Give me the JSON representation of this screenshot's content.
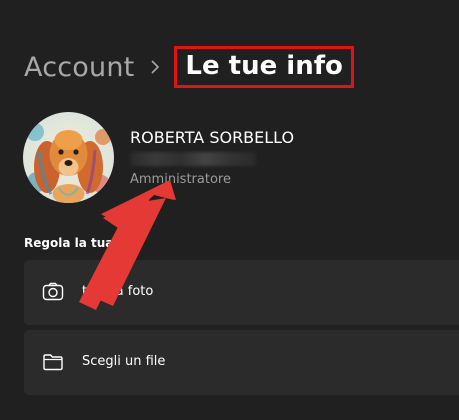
{
  "breadcrumb": {
    "parent": "Account",
    "current": "Le tue info"
  },
  "user": {
    "name": "ROBERTA SORBELLO",
    "role": "Amministratore"
  },
  "section": {
    "label": "Regola la tua f"
  },
  "actions": [
    {
      "label": "ta una foto",
      "icon": "camera-icon"
    },
    {
      "label": "Scegli un file",
      "icon": "folder-icon"
    }
  ],
  "colors": {
    "background": "#202020",
    "card": "#2b2b2b",
    "highlight_border": "#e11414",
    "arrow": "#e53935"
  }
}
